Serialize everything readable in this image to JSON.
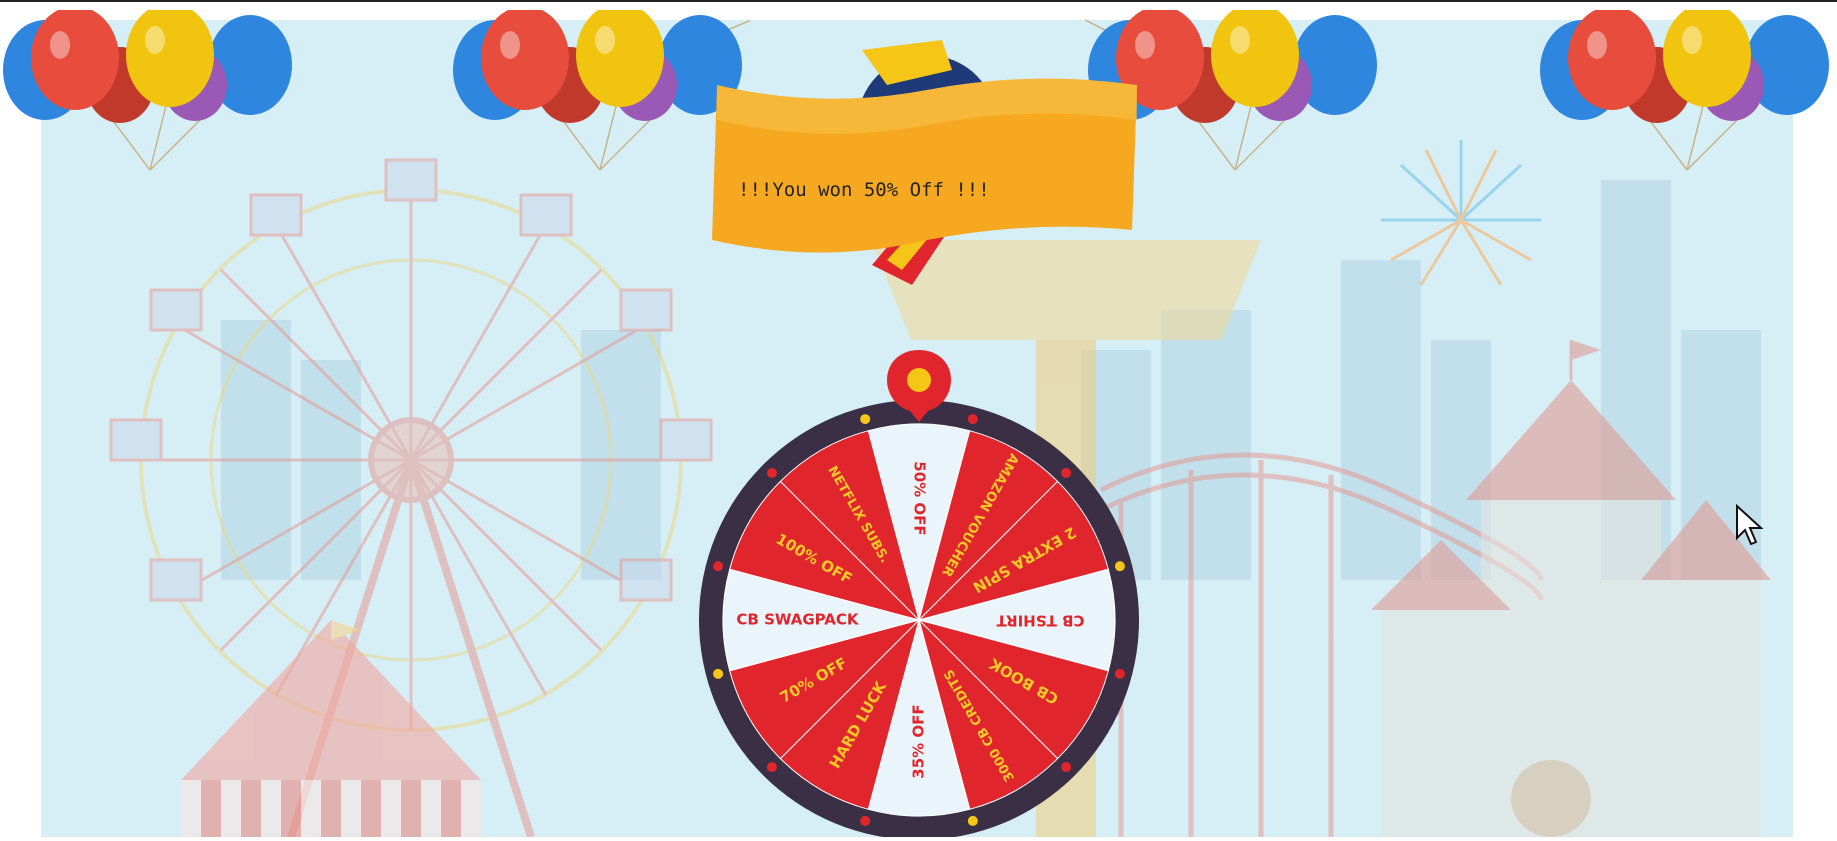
{
  "banner": {
    "message": "!!!You won 50% Off !!!"
  },
  "wheel": {
    "segments": [
      "50% OFF",
      "AMAZON VOUCHER",
      "2 EXTRA SPIN",
      "CB TSHIRT",
      "CB BOOK",
      "3000 CB CREDITS",
      "35% OFF",
      "HARD LUCK",
      "70% OFF",
      "CB SWAGPACK",
      "100% OFF",
      "NETFLIX SUBS."
    ],
    "colors": {
      "red": "#e1252c",
      "light": "#eaf4fb",
      "rim": "#3a2f44",
      "text_on_red": "#f7c928",
      "text_on_light": "#e1252c"
    }
  },
  "scene": {
    "sky": "#d6eef6",
    "banner_color": "#f6a820"
  },
  "icons": [
    "balloon-cluster-icon",
    "ferris-wheel-icon",
    "circus-tent-icon",
    "castle-icon",
    "fireworks-icon",
    "pointer-pin-icon",
    "mouse-cursor-icon",
    "marquee-sign-icon"
  ]
}
